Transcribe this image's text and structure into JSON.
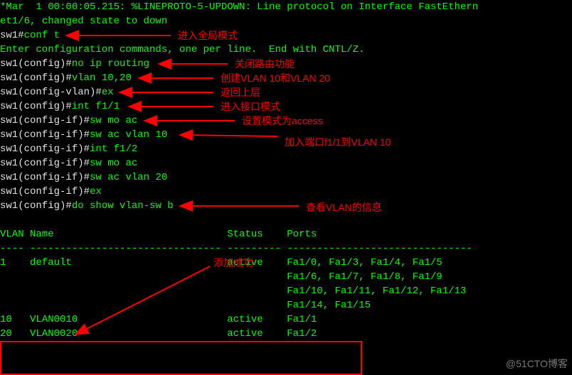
{
  "log": {
    "l1": "*Mar  1 00:00:05.215: %LINEPROTO-5-UPDOWN: Line protocol on Interface FastEthern",
    "l2": "et1/6, changed state to down"
  },
  "cli": {
    "p_priv": "sw1#",
    "cmd_conft": "conf t",
    "enter_conf": "Enter configuration commands, one per line.  End with CNTL/Z.",
    "p_cfg": "sw1(config)#",
    "cmd_noiprouting": "no ip routing",
    "cmd_vlan1020": "vlan 10,20",
    "p_cfgvlan": "sw1(config-vlan)#",
    "cmd_ex": "ex",
    "cmd_intf11": "int f1/1",
    "p_cfgif": "sw1(config-if)#",
    "cmd_swmoac": "sw mo ac",
    "cmd_swacvlan10": "sw ac vlan 10",
    "cmd_intf12": "int f1/2",
    "cmd_swacvlan20": "sw ac vlan 20",
    "cmd_doshow": "do show vlan-sw b"
  },
  "table": {
    "hdr": "VLAN Name                             Status    Ports",
    "dash": "---- -------------------------------- --------- -------------------------------",
    "r1": "1    default                          active    Fa1/0, Fa1/3, Fa1/4, Fa1/5",
    "r1b": "                                                Fa1/6, Fa1/7, Fa1/8, Fa1/9",
    "r1c": "                                                Fa1/10, Fa1/11, Fa1/12, Fa1/13",
    "r1d": "                                                Fa1/14, Fa1/15",
    "r10": "10   VLAN0010                         active    Fa1/1",
    "r20": "20   VLAN0020                         active    Fa1/2"
  },
  "annotations": {
    "conft": "进入全局模式",
    "noip": "关闭路由功能",
    "vlan": "创建VLAN 10和VLAN 20",
    "ex": "返回上层",
    "intf": "进入接口模式",
    "moac": "设置模式为access",
    "acvlan10": "加入端口f1/1到VLAN 10",
    "doshow": "查看VLAN的信息",
    "success": "添加成功"
  },
  "watermark": "@51CTO博客"
}
